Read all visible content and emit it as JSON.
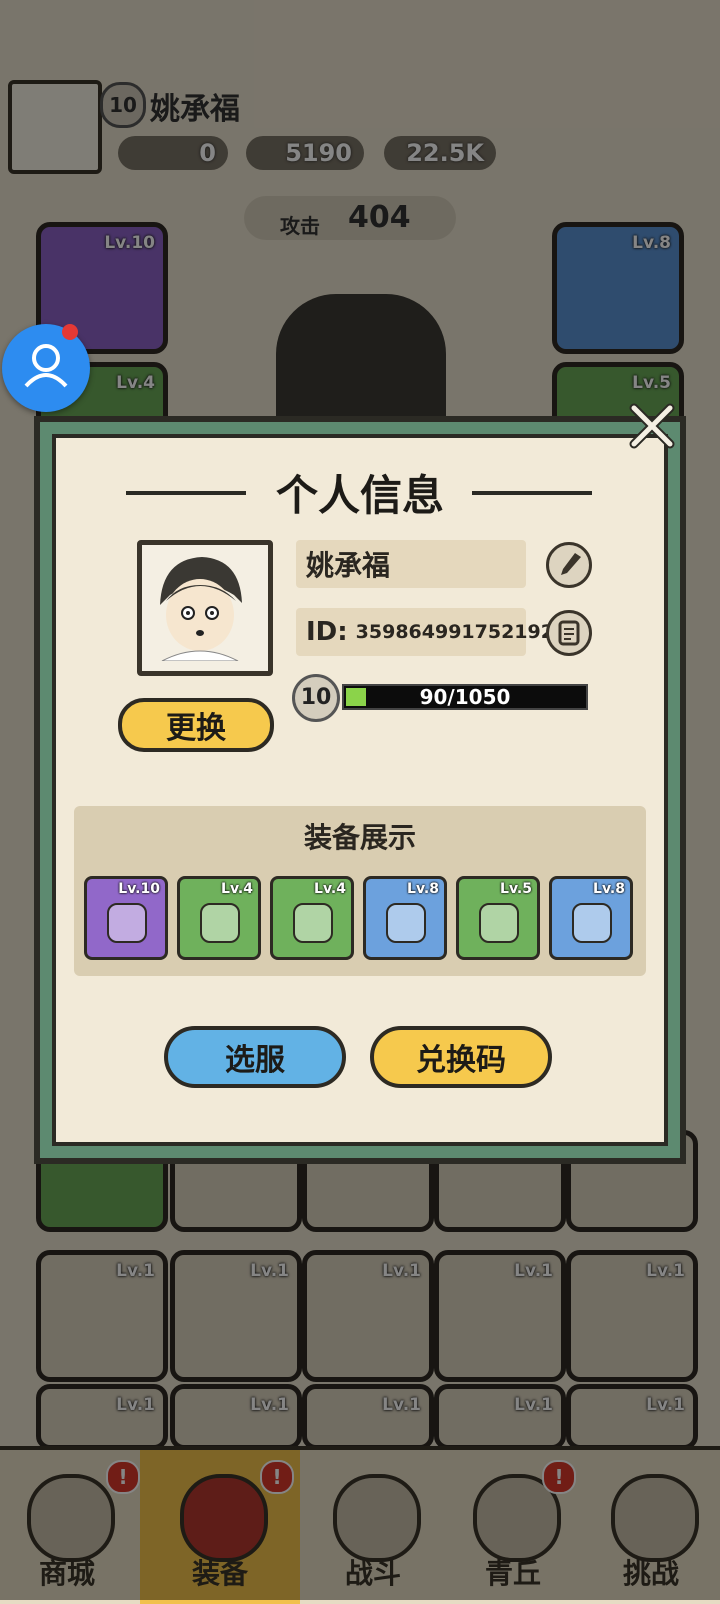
{
  "player": {
    "name": "姚承福",
    "level": "10",
    "id_label": "ID:",
    "id_value": "359864991752192",
    "exp_text": "90/1050",
    "exp_progress": 0.086
  },
  "resources": {
    "res1": "0",
    "res2": "5190",
    "res3": "22.5K"
  },
  "attack": {
    "label": "攻击",
    "value": "404"
  },
  "background_slots": {
    "weapon_lv": "Lv.10",
    "ring_lv": "Lv.8",
    "left2_lv": "Lv.4",
    "right2_lv": "Lv.5",
    "grid_lv": "Lv.1"
  },
  "modal": {
    "title": "个人信息",
    "change_button": "更换",
    "equip_title": "装备展示",
    "server_button": "选服",
    "redeem_button": "兑换码"
  },
  "equip_items": [
    {
      "lv": "Lv.10",
      "color": "purple",
      "icon": "bow-icon"
    },
    {
      "lv": "Lv.4",
      "color": "green",
      "icon": "armor-icon"
    },
    {
      "lv": "Lv.4",
      "color": "green",
      "icon": "cape-icon"
    },
    {
      "lv": "Lv.8",
      "color": "blue",
      "icon": "ring-icon"
    },
    {
      "lv": "Lv.5",
      "color": "green",
      "icon": "boots-icon"
    },
    {
      "lv": "Lv.8",
      "color": "blue",
      "icon": "amulet-icon"
    }
  ],
  "nav": {
    "shop": "商城",
    "equip": "装备",
    "battle": "战斗",
    "qingqiu": "青丘",
    "challenge": "挑战"
  },
  "colors": {
    "modal_bg": "#f2ead8",
    "frame_green": "#5d8a70",
    "yellow": "#f6c94d",
    "blue": "#62b2e5",
    "exp_green": "#8bd34a"
  }
}
